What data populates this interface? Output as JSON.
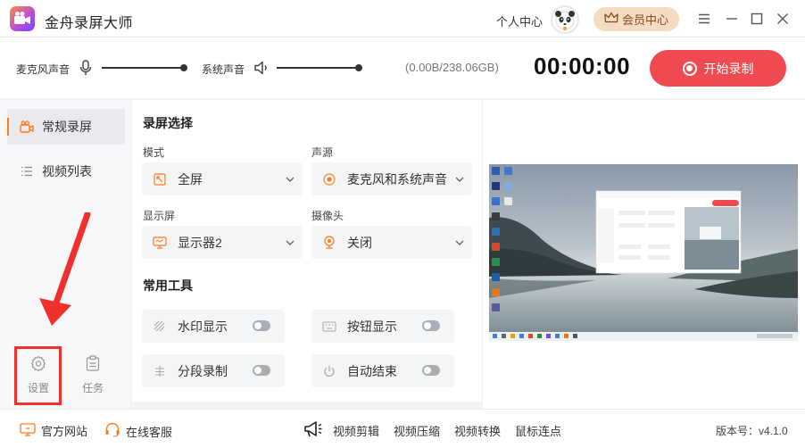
{
  "window": {
    "title": "金舟录屏大师"
  },
  "header": {
    "profile_label": "个人中心",
    "vip_label": "会员中心"
  },
  "audio": {
    "mic_label": "麦克风声音",
    "mic_level": 1.0,
    "system_label": "系统声音",
    "system_level": 1.0,
    "disk_usage": "(0.00B/238.06GB)",
    "timer": "00:00:00",
    "record_label": "开始录制"
  },
  "sidebar": {
    "items": [
      {
        "label": "常规录屏",
        "active": true
      },
      {
        "label": "视频列表",
        "active": false
      }
    ],
    "settings_label": "设置",
    "tasks_label": "任务"
  },
  "screen_selection": {
    "title": "录屏选择",
    "mode_label": "模式",
    "mode_value": "全屏",
    "audio_source_label": "声源",
    "audio_source_value": "麦克风和系统声音",
    "display_label": "显示屏",
    "display_value": "显示器2",
    "camera_label": "摄像头",
    "camera_value": "关闭"
  },
  "tools": {
    "title": "常用工具",
    "items": [
      {
        "label": "水印显示",
        "on": false
      },
      {
        "label": "按钮显示",
        "on": false
      },
      {
        "label": "分段录制",
        "on": false
      },
      {
        "label": "自动结束",
        "on": false
      }
    ]
  },
  "footer": {
    "website_label": "官方网站",
    "service_label": "在线客服",
    "links": [
      "视频剪辑",
      "视频压缩",
      "视频转换",
      "鼠标连点"
    ],
    "version": "版本号：v4.1.0"
  },
  "colors": {
    "accent": "#ef4a50",
    "active_bar": "#ff7a1a",
    "vip_bg": "#f3dcc2",
    "highlight": "#f0302d"
  },
  "icons": [
    "app-logo",
    "panda-avatar",
    "crown-icon",
    "menu-icon",
    "minimize-icon",
    "maximize-icon",
    "close-icon",
    "microphone-icon",
    "speaker-icon",
    "record-icon",
    "screen-record-icon",
    "video-list-icon",
    "settings-gear-icon",
    "task-icon",
    "fullscreen-icon",
    "audio-source-icon",
    "monitor-icon",
    "camera-icon",
    "watermark-icon",
    "keyboard-icon",
    "segment-icon",
    "power-icon",
    "website-icon",
    "headset-icon",
    "megaphone-icon"
  ]
}
